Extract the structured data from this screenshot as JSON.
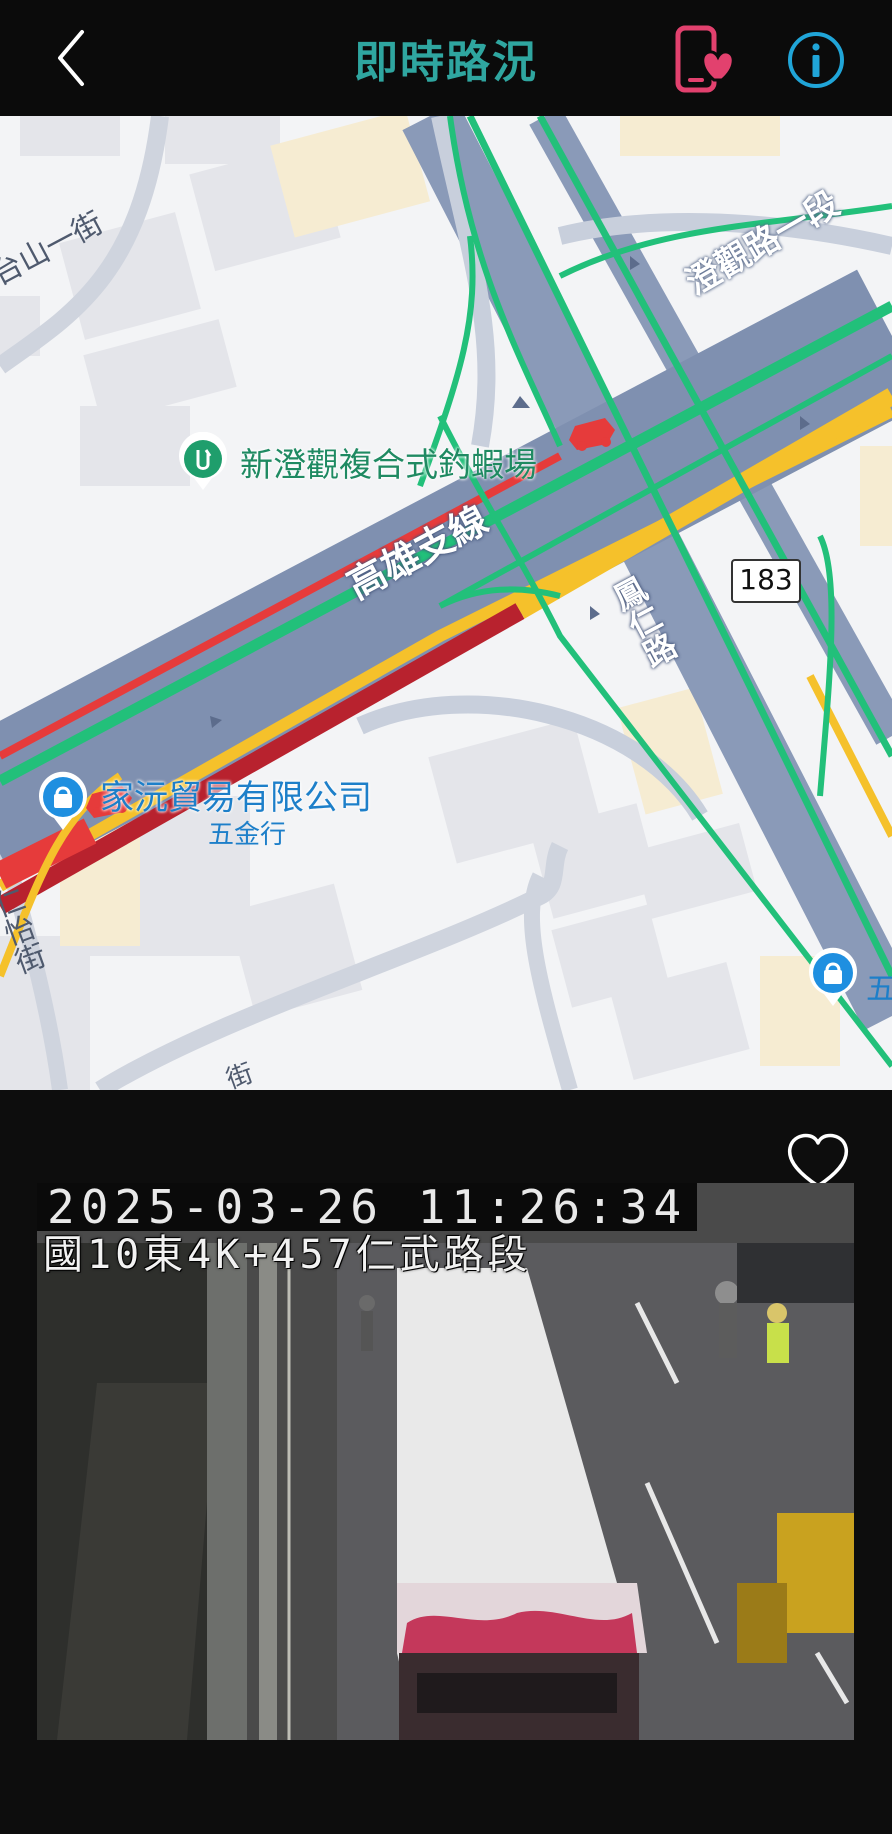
{
  "header": {
    "title": "即時路況"
  },
  "map": {
    "roads": {
      "street_top_left": "台山一街",
      "road_top_right": "澄觀路一段",
      "highway": "高雄支線",
      "road_vertical": "鳳仁路",
      "route_badge": "183",
      "street_left": "仁怡街",
      "street_bottom": "街"
    },
    "pois": [
      {
        "name": "新澄觀複合式釣蝦場",
        "icon": "fishing-poi-icon"
      },
      {
        "name": "家沅貿易有限公司",
        "subtitle": "五金行",
        "icon": "shop-poi-icon"
      },
      {
        "name": "五",
        "icon": "shop-poi-icon"
      }
    ],
    "colors": {
      "free_flow": "#22c07a",
      "slow": "#f5c12b",
      "congested": "#b8222e",
      "jam": "#e63b3b"
    }
  },
  "camera": {
    "timestamp": "2025-03-26 11:26:34",
    "location": "國10東4K+457仁武路段"
  }
}
